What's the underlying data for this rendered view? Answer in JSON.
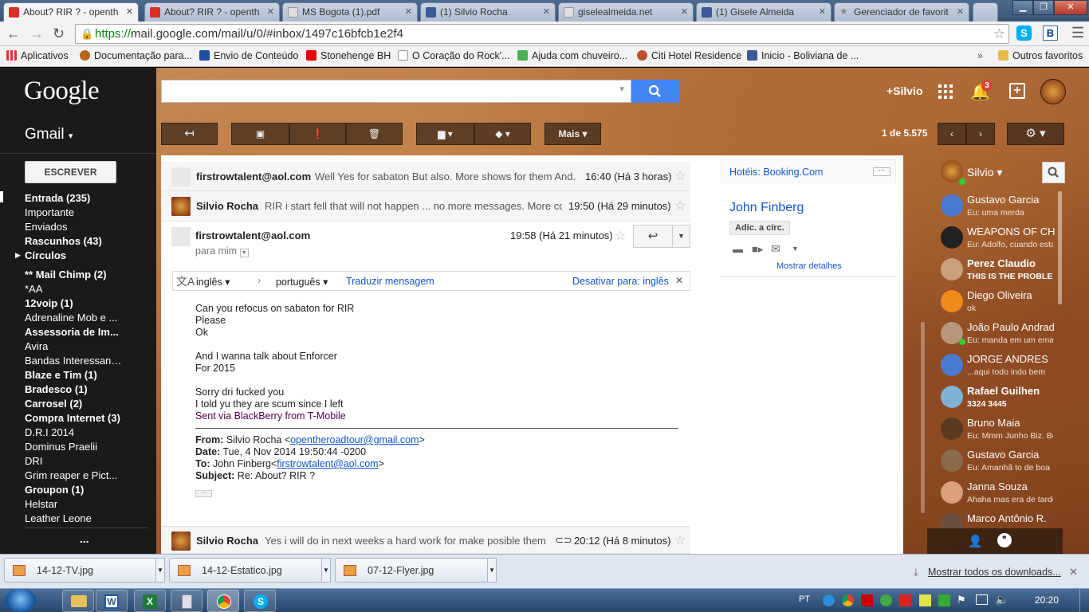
{
  "browser": {
    "tabs": [
      {
        "title": "About? RIR ? - openth",
        "icon": "gmail-icon",
        "active": true
      },
      {
        "title": "About? RIR ? - openth",
        "icon": "gmail-icon"
      },
      {
        "title": "MS Bogota (1).pdf",
        "icon": "document-icon"
      },
      {
        "title": "(1) Silvio Rocha",
        "icon": "facebook-icon"
      },
      {
        "title": "giselealmeida.net",
        "icon": "document-icon"
      },
      {
        "title": "(1) Gisele Almeida",
        "icon": "facebook-icon"
      },
      {
        "title": "Gerenciador de favorit",
        "icon": "star-icon"
      }
    ],
    "url_scheme": "https://",
    "url_rest": "mail.google.com/mail/u/0/#inbox/1497c16bfcb1e2f4",
    "bookmarks": [
      "Aplicativos",
      "Documentação para...",
      "Envio de Conteúdo",
      "Stonehenge BH",
      "O Coração do Rock'...",
      "Ajuda com chuveiro...",
      "Citi Hotel Residence",
      "Inicio - Boliviana de ...",
      "Outros favoritos"
    ],
    "bookmarks_more": "»"
  },
  "gmail": {
    "logo": "Google",
    "switcher": "Gmail",
    "compose": "ESCREVER",
    "user": "+Silvio",
    "notifications": "3",
    "toolbar": {
      "more": "Mais",
      "pagination": "1 de 5.575"
    },
    "labels": [
      {
        "text": "Entrada (235)",
        "bold": true
      },
      {
        "text": "Importante",
        "bold": false
      },
      {
        "text": "Enviados",
        "bold": false
      },
      {
        "text": "Rascunhos (43)",
        "bold": true
      },
      {
        "text": "Círculos",
        "bold": true
      },
      {
        "text": "** Mail Chimp (2)",
        "bold": true
      },
      {
        "text": "*AA",
        "bold": false
      },
      {
        "text": "12voip (1)",
        "bold": true
      },
      {
        "text": "Adrenaline Mob e ...",
        "bold": false
      },
      {
        "text": "Assessoria de Im...",
        "bold": true
      },
      {
        "text": "Avira",
        "bold": false
      },
      {
        "text": "Bandas Interessant...",
        "bold": false
      },
      {
        "text": "Blaze e Tim (1)",
        "bold": true
      },
      {
        "text": "Bradesco (1)",
        "bold": true
      },
      {
        "text": "Carrosel (2)",
        "bold": true
      },
      {
        "text": "Compra Internet (3)",
        "bold": true
      },
      {
        "text": "D.R.I 2014",
        "bold": false
      },
      {
        "text": "Dominus Praelii",
        "bold": false
      },
      {
        "text": "DRI",
        "bold": false
      },
      {
        "text": "Grim reaper e Pict...",
        "bold": false
      },
      {
        "text": "Groupon (1)",
        "bold": true
      },
      {
        "text": "Helstar",
        "bold": false
      },
      {
        "text": "Leather Leone",
        "bold": false
      }
    ],
    "more_labels": "...",
    "thread": [
      {
        "sender": "firstrowtalent@aol.com",
        "snippet": "Well Yes for sabaton But also. More shows for them And.",
        "time": "16:40 (Há 3 horas)"
      },
      {
        "sender": "Silvio Rocha",
        "snippet": "RIR i start fell that will not happen ... no more messages. More co",
        "time": "19:50 (Há 29 minutos)"
      }
    ],
    "open_message": {
      "sender": "firstrowtalent@aol.com",
      "to": "para mim",
      "time": "19:58 (Há 21 minutos)",
      "translate": {
        "from": "inglês",
        "to": "português",
        "action": "Traduzir mensagem",
        "disable": "Desativar para: inglês"
      },
      "body_lines": [
        "Can you refocus on sabaton for RIR",
        "Please",
        "Ok",
        "",
        "And I wanna talk about Enforcer",
        "For 2015",
        "",
        "Sorry dri fucked you",
        "I told yu they are scum since I left"
      ],
      "signature": "Sent via BlackBerry from T-Mobile",
      "quoted": {
        "from_label": "From:",
        "from_name": "Silvio Rocha <",
        "from_email": "opentheroadtour@gmail.com",
        "from_close": ">",
        "date_label": "Date:",
        "date": "Tue, 4 Nov 2014 19:50:44 -0200",
        "to_label": "To:",
        "to_name": "John Finberg<",
        "to_email": "firstrowtalent@aol.com",
        "to_close": ">",
        "subject_label": "Subject:",
        "subject": "Re: About? RIR ?"
      },
      "ellipsis": "···"
    },
    "last_message": {
      "sender": "Silvio Rocha",
      "snippet": "Yes i will do in next weeks a hard work for make posible them",
      "time": "20:12 (Há 8 minutos)"
    },
    "contact_card": {
      "ad_prefix": "Hotéis:",
      "ad_link": "Booking.Com",
      "name": "John Finberg",
      "add_circle": "Adic. a círc.",
      "details": "Mostrar detalhes"
    },
    "chat": {
      "me": "Silvio",
      "contacts": [
        {
          "name": "Gustavo Garcia",
          "status": "Eu: uma merda",
          "bold": false,
          "color": "#4a7bd0"
        },
        {
          "name": "WEAPONS OF CHOICE",
          "status": "Eu: Adolfo, cuando estarás",
          "bold": false,
          "color": "#222"
        },
        {
          "name": "Perez Claudio",
          "status": "THIS IS THE PROBLEM",
          "bold": true,
          "color": "#c9a07a"
        },
        {
          "name": "Diego Oliveira",
          "status": "ok",
          "bold": false,
          "color": "#f08a1a"
        },
        {
          "name": "João Paulo Andrade",
          "status": "Eu: manda em um email",
          "bold": false,
          "color": "#b9967a"
        },
        {
          "name": "JORGE ANDRES",
          "status": "...aqui todo indo bem",
          "bold": false,
          "color": "#4a7bd0"
        },
        {
          "name": "Rafael Guilhen",
          "status": "3324 3445",
          "bold": true,
          "color": "#7fb0d6"
        },
        {
          "name": "Bruno Maia",
          "status": "Eu: Mmm Junho Biz. Bom",
          "bold": false,
          "color": "#5a3a20"
        },
        {
          "name": "Gustavo Garcia",
          "status": "Eu: Amanhã to de boa",
          "bold": false,
          "color": "#8a6a4a"
        },
        {
          "name": "Janna Souza",
          "status": "Ahaha mas era de tarde",
          "bold": false,
          "color": "#d9a07a"
        },
        {
          "name": "Marco Antônio R.",
          "status": "",
          "bold": false,
          "color": "#6a5040"
        }
      ]
    }
  },
  "downloads": {
    "files": [
      "14-12-TV.jpg",
      "14-12-Estatico.jpg",
      "07-12-Flyer.jpg"
    ],
    "show_all": "Mostrar todos os downloads..."
  },
  "taskbar": {
    "lang": "PT",
    "clock": "20:20"
  }
}
